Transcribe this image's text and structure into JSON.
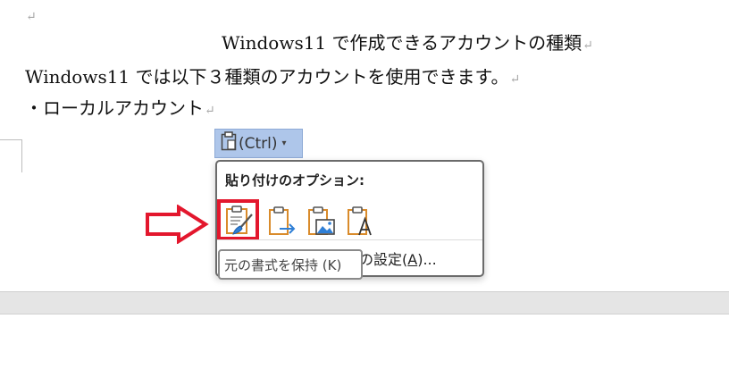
{
  "document": {
    "empty_paragraph_mark": "↵",
    "title": "Windows11 で作成できるアカウントの種類",
    "intro": "Windows11 では以下３種類のアカウントを使用できます。",
    "bullet": "・ローカルアカウント",
    "paragraph_mark": "↵"
  },
  "paste_tag": {
    "label": "(Ctrl)",
    "arrow": "▾",
    "icon": "clipboard-icon"
  },
  "paste_menu": {
    "heading": "貼り付けのオプション:",
    "options": [
      {
        "icon": "paste-keep-formatting-icon",
        "selected": true
      },
      {
        "icon": "paste-merge-formatting-icon"
      },
      {
        "icon": "paste-picture-icon"
      },
      {
        "icon": "paste-text-only-icon"
      }
    ],
    "defaults_prefix": "の設定(",
    "defaults_accel": "A",
    "defaults_suffix": ")..."
  },
  "tooltip": {
    "text": "元の書式を保持 (K)"
  },
  "colors": {
    "highlight_red": "#e3172d",
    "tag_blue": "#aec6ea",
    "clipboard_orange": "#d98b2b",
    "accent_blue": "#2f7fd6"
  }
}
